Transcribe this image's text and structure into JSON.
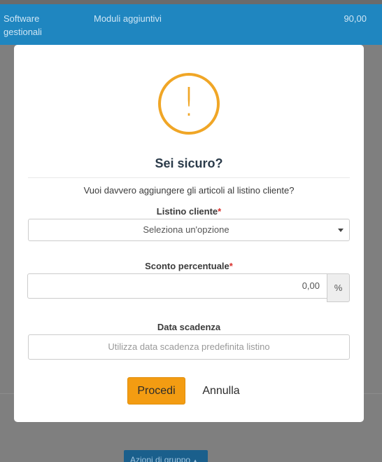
{
  "background": {
    "row": {
      "category": "Software gestionali",
      "description": "Moduli aggiuntivi",
      "price": "90,00"
    },
    "group_actions_label": "Azioni di gruppo"
  },
  "dialog": {
    "icon": "warning-exclamation-icon",
    "icon_glyph": "!",
    "title": "Sei sicuro?",
    "question": "Vuoi davvero aggiungere gli articoli al listino cliente?",
    "listino": {
      "label": "Listino cliente",
      "required_mark": "*",
      "placeholder": "Seleziona un'opzione"
    },
    "sconto": {
      "label": "Sconto percentuale",
      "required_mark": "*",
      "value": "0,00",
      "addon": "%"
    },
    "scadenza": {
      "label": "Data scadenza",
      "placeholder": "Utilizza data scadenza predefinita listino"
    },
    "confirm_label": "Procedi",
    "cancel_label": "Annulla"
  },
  "colors": {
    "accent": "#f39c12",
    "warning": "#f0a626",
    "required": "#d9302c",
    "row_highlight": "#1f86c0"
  }
}
